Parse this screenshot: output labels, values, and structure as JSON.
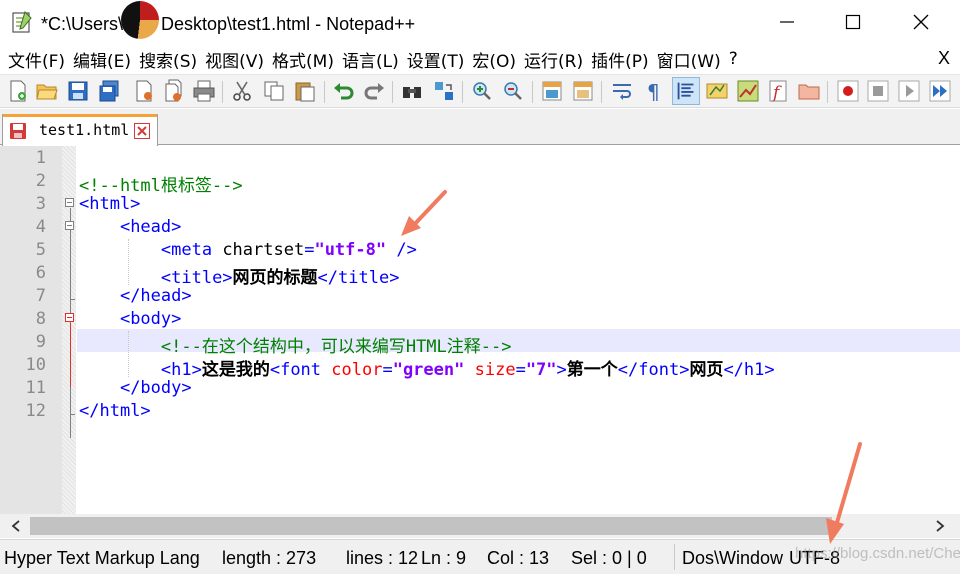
{
  "window": {
    "title_prefix": "*C:\\Users\\",
    "title_suffix": "Desktop\\test1.html - Notepad++",
    "minimize_glyph": "—",
    "maximize_glyph": "☐",
    "close_glyph": "✕"
  },
  "menu": {
    "items": [
      "文件(F)",
      "编辑(E)",
      "搜索(S)",
      "视图(V)",
      "格式(M)",
      "语言(L)",
      "设置(T)",
      "宏(O)",
      "运行(R)",
      "插件(P)",
      "窗口(W)",
      "?"
    ],
    "close_glyph": "X"
  },
  "toolbar": {
    "icons": [
      "new-file-icon",
      "open-file-icon",
      "save-icon",
      "save-all-icon",
      "close-icon",
      "close-all-icon",
      "print-icon",
      "cut-icon",
      "copy-icon",
      "paste-icon",
      "undo-icon",
      "redo-icon",
      "find-icon",
      "replace-icon",
      "zoom-in-icon",
      "zoom-out-icon",
      "sync-vertical-icon",
      "sync-horizontal-icon",
      "word-wrap-icon",
      "show-all-chars-icon",
      "indent-guide-icon",
      "user-language-icon",
      "doc-map-icon",
      "function-list-icon",
      "folder-workspace-icon",
      "record-macro-icon",
      "stop-record-icon",
      "playback-macro-icon",
      "run-macro-multiple-icon"
    ],
    "active": "indent-guide-icon"
  },
  "tab": {
    "label": "test1.html",
    "colors": {
      "accent": "#f5a23a",
      "close": "#d23a3a"
    }
  },
  "editor": {
    "line_numbers": [
      "1",
      "2",
      "3",
      "4",
      "5",
      "6",
      "7",
      "8",
      "9",
      "10",
      "11",
      "12"
    ],
    "lines": [
      {
        "tokens": []
      },
      {
        "tokens": [
          {
            "t": "cmt",
            "v": "<!--html根标签-->"
          }
        ]
      },
      {
        "tokens": [
          {
            "t": "tag",
            "v": "<html>"
          }
        ]
      },
      {
        "tokens": [
          {
            "t": "plain",
            "v": "    "
          },
          {
            "t": "tag",
            "v": "<head>"
          }
        ]
      },
      {
        "tokens": [
          {
            "t": "plain",
            "v": "        "
          },
          {
            "t": "tag",
            "v": "<meta "
          },
          {
            "t": "plain",
            "v": "chartset"
          },
          {
            "t": "tag",
            "v": "="
          },
          {
            "t": "str",
            "v": "\"utf-8\""
          },
          {
            "t": "tag",
            "v": " />"
          }
        ]
      },
      {
        "tokens": [
          {
            "t": "plain",
            "v": "        "
          },
          {
            "t": "tag",
            "v": "<title>"
          },
          {
            "t": "text",
            "v": "网页的标题"
          },
          {
            "t": "tag",
            "v": "</title>"
          }
        ]
      },
      {
        "tokens": [
          {
            "t": "plain",
            "v": "    "
          },
          {
            "t": "tag",
            "v": "</head>"
          }
        ]
      },
      {
        "tokens": [
          {
            "t": "plain",
            "v": "    "
          },
          {
            "t": "tag",
            "v": "<body>"
          }
        ]
      },
      {
        "tokens": [
          {
            "t": "plain",
            "v": "        "
          },
          {
            "t": "cmt",
            "v": "<!--在这个结构中，可以来编写HTML注释-->"
          }
        ]
      },
      {
        "tokens": [
          {
            "t": "plain",
            "v": "        "
          },
          {
            "t": "tag",
            "v": "<h1>"
          },
          {
            "t": "text",
            "v": "这是我的"
          },
          {
            "t": "tag",
            "v": "<font "
          },
          {
            "t": "attr",
            "v": "color"
          },
          {
            "t": "tag",
            "v": "="
          },
          {
            "t": "str",
            "v": "\"green\""
          },
          {
            "t": "tag",
            "v": " "
          },
          {
            "t": "attr",
            "v": "size"
          },
          {
            "t": "tag",
            "v": "="
          },
          {
            "t": "str",
            "v": "\"7\""
          },
          {
            "t": "tag",
            "v": ">"
          },
          {
            "t": "text",
            "v": "第一个"
          },
          {
            "t": "tag",
            "v": "</font>"
          },
          {
            "t": "text",
            "v": "网页"
          },
          {
            "t": "tag",
            "v": "</h1>"
          }
        ]
      },
      {
        "tokens": [
          {
            "t": "plain",
            "v": "    "
          },
          {
            "t": "tag",
            "v": "</body>"
          }
        ]
      },
      {
        "tokens": [
          {
            "t": "tag",
            "v": "</html>"
          }
        ]
      }
    ],
    "current_line": 9
  },
  "status": {
    "language": "Hyper Text Markup Lang",
    "length": "length : 273",
    "lines": "lines : 12",
    "ln": "Ln : 9",
    "col": "Col : 13",
    "sel": "Sel : 0 | 0",
    "eol": "Dos\\Window",
    "encoding": "UTF-8",
    "watermark": "https://blog.csdn.net/Cherry_Zj"
  },
  "colors": {
    "comment": "#008000",
    "tag": "#0000ff",
    "attribute": "#ff0000",
    "string": "#8000ff",
    "current_line": "#e8e8ff",
    "annotation_arrow": "#f07b5f"
  }
}
